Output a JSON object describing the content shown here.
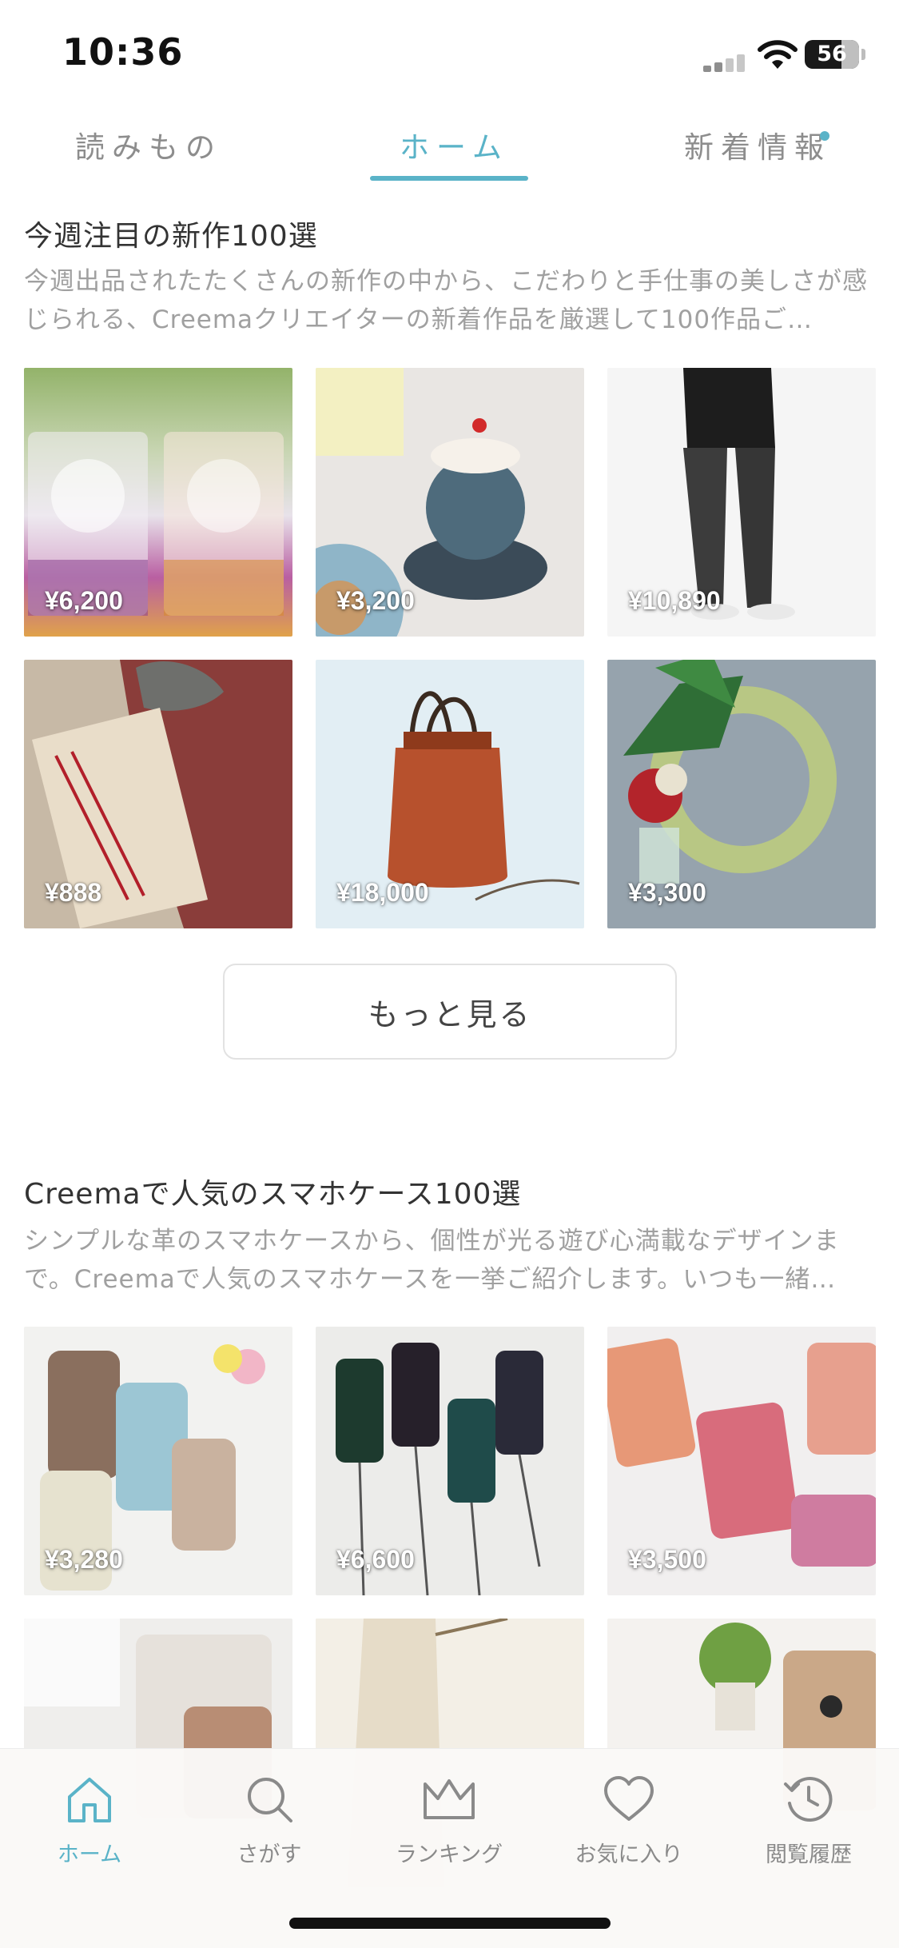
{
  "status_bar": {
    "time": "10:36",
    "battery_level": "56"
  },
  "top_tabs": [
    {
      "label": "読みもの",
      "active": false
    },
    {
      "label": "ホーム",
      "active": true
    },
    {
      "label": "新着情報",
      "active": false,
      "has_dot": true
    }
  ],
  "sections": [
    {
      "title": "今週注目の新作100選",
      "description": "今週出品されたたくさんの新作の中から、こだわりと手仕事の美しさが感じられる、Creemaクリエイターの新着作品を厳選して100作品ご…",
      "items": [
        {
          "price": "¥6,200"
        },
        {
          "price": "¥3,200"
        },
        {
          "price": "¥10,890"
        },
        {
          "price": "¥888"
        },
        {
          "price": "¥18,000"
        },
        {
          "price": "¥3,300"
        }
      ],
      "more_label": "もっと見る"
    },
    {
      "title": "Creemaで人気のスマホケース100選",
      "description": "シンプルな革のスマホケースから、個性が光る遊び心満載なデザインまで。Creemaで人気のスマホケースを一挙ご紹介します。いつも一緒…",
      "items": [
        {
          "price": "¥3,280"
        },
        {
          "price": "¥6,600"
        },
        {
          "price": "¥3,500"
        },
        {
          "price": ""
        },
        {
          "price": ""
        },
        {
          "price": ""
        }
      ]
    }
  ],
  "bottom_nav": [
    {
      "label": "ホーム",
      "icon": "home-icon",
      "active": true
    },
    {
      "label": "さがす",
      "icon": "search-icon",
      "active": false
    },
    {
      "label": "ランキング",
      "icon": "crown-icon",
      "active": false
    },
    {
      "label": "お気に入り",
      "icon": "heart-icon",
      "active": false
    },
    {
      "label": "閲覧履歴",
      "icon": "history-icon",
      "active": false
    }
  ],
  "colors": {
    "accent": "#5ab3c8",
    "muted_text": "#a0a0a0",
    "nav_inactive": "#8a8a8a"
  }
}
